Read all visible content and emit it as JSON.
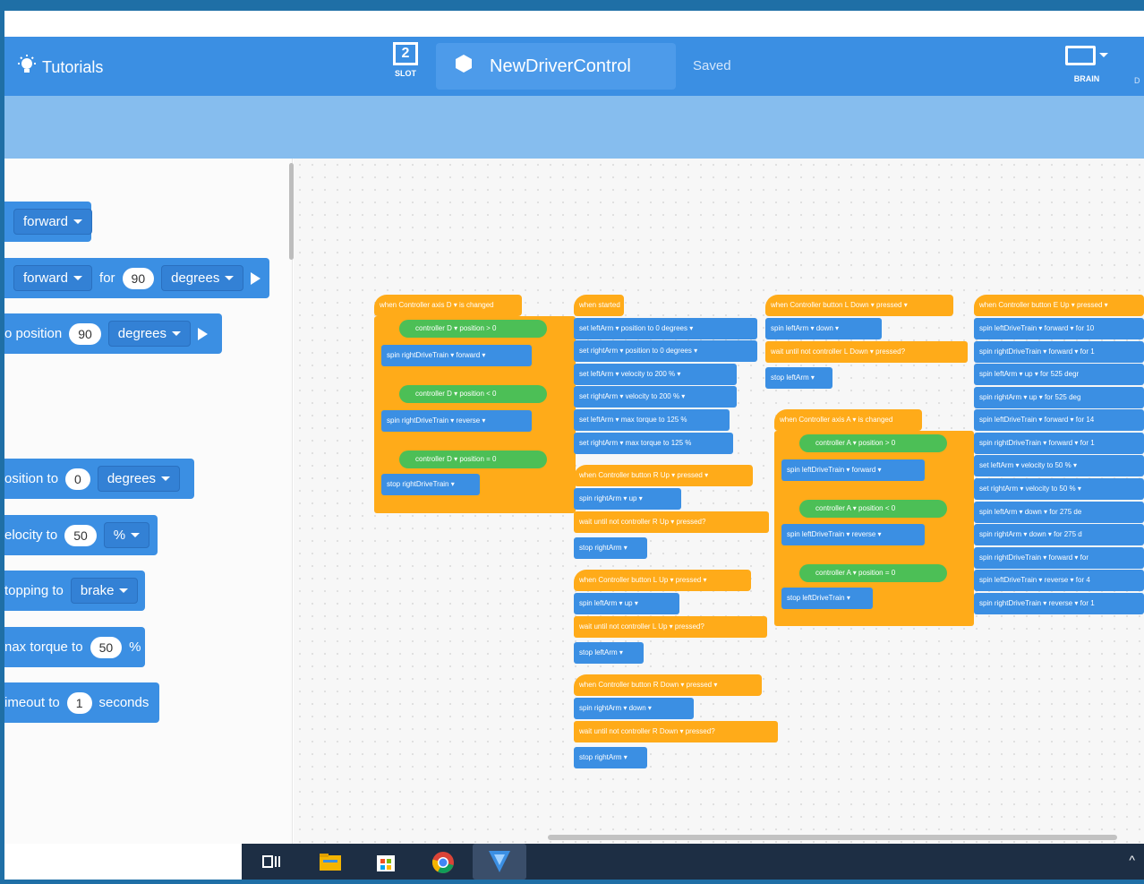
{
  "topbar": {
    "tutorials": "Tutorials",
    "slot_number": "2",
    "slot_label": "SLOT",
    "project_name": "NewDriverControl",
    "saved": "Saved",
    "brain_label": "BRAIN",
    "cut_label": "D"
  },
  "palette": {
    "items": [
      {
        "dir": "forward"
      },
      {
        "dir": "forward",
        "for": "for",
        "amount": "90",
        "unit": "degrees"
      },
      {
        "label": "o position",
        "amount": "90",
        "unit": "degrees"
      },
      {
        "label": "osition to",
        "amount": "0",
        "unit": "degrees"
      },
      {
        "label": "elocity to",
        "amount": "50",
        "unit": "%"
      },
      {
        "label": "topping to",
        "mode": "brake"
      },
      {
        "label": "nax torque to",
        "amount": "50",
        "unit": "%"
      },
      {
        "label": "imeout to",
        "amount": "1",
        "unit": "seconds"
      }
    ]
  },
  "scripts": {
    "s1": {
      "hat": "when Controller axis  D ▾  is changed",
      "b1": "spin  rightDriveTrain ▾     forward ▾",
      "b2": "spin  rightDriveTrain ▾     reverse ▾",
      "b3": "stop  rightDriveTrain ▾",
      "if": "if",
      "then": "then",
      "c1": "controller  D ▾  position  >  0",
      "c2": "controller  D ▾  position  <  0",
      "c3": "controller  D ▾  position  =  0"
    },
    "s2": {
      "hat": "when started",
      "l1": "set   leftArm ▾    position to  0   degrees ▾",
      "l2": "set   rightArm ▾   position to  0   degrees ▾",
      "l3": "set   leftArm ▾    velocity to  200   % ▾",
      "l4": "set   rightArm ▾   velocity to  200   % ▾",
      "l5": "set   leftArm ▾    max torque to  125  %",
      "l6": "set   rightArm ▾   max torque to  125  %"
    },
    "s3": {
      "hat": "when Controller button  R Up ▾     pressed ▾",
      "b1": "spin   rightArm ▾    up ▾",
      "w": "wait until   not   controller  R Up ▾   pressed?",
      "b2": "stop   rightArm ▾"
    },
    "s4": {
      "hat": "when Controller button  L Up ▾     pressed ▾",
      "b1": "spin   leftArm ▾    up ▾",
      "w": "wait until   not   controller  L Up ▾   pressed?",
      "b2": "stop   leftArm ▾"
    },
    "s5": {
      "hat": "when Controller button  R Down ▾    pressed ▾",
      "b1": "spin   rightArm ▾    down ▾",
      "w": "wait until   not   controller  R Down ▾   pressed?",
      "b2": "stop   rightArm ▾"
    },
    "s6": {
      "hat": "when Controller button  L Down ▾     pressed ▾",
      "b1": "spin   leftArm ▾    down ▾",
      "w": "wait until   not   controller  L Down ▾   pressed?",
      "b2": "stop   leftArm ▾"
    },
    "s7": {
      "hat": "when Controller axis  A ▾  is changed",
      "b1": "spin  leftDriveTrain ▾     forward ▾",
      "b2": "spin  leftDriveTrain ▾     reverse ▾",
      "b3": "stop  leftDriveTrain ▾",
      "c1": "controller  A ▾  position  >  0",
      "c2": "controller  A ▾  position  <  0",
      "c3": "controller  A ▾  position  =  0"
    },
    "s8": {
      "hat": "when Controller button  E Up ▾     pressed ▾",
      "lines": [
        "spin   leftDriveTrain ▾     forward ▾   for  10",
        "spin   rightDriveTrain ▾    forward ▾   for  1",
        "spin   leftArm ▾    up ▾   for  525   degr",
        "spin   rightArm ▾    up ▾   for  525   deg",
        "spin   leftDriveTrain ▾     forward ▾   for  14",
        "spin   rightDriveTrain ▾    forward ▾   for  1",
        "set   leftArm ▾   velocity to  50   % ▾",
        "set   rightArm ▾   velocity to  50   % ▾",
        "spin   leftArm ▾    down ▾   for  275   de",
        "spin   rightArm ▾    down ▾   for  275   d",
        "spin   rightDriveTrain ▾    forward ▾   for",
        "spin   leftDriveTrain ▾     reverse ▾   for  4",
        "spin   rightDriveTrain ▾    reverse ▾   for  1"
      ]
    }
  },
  "taskbar": {
    "up": "^"
  }
}
